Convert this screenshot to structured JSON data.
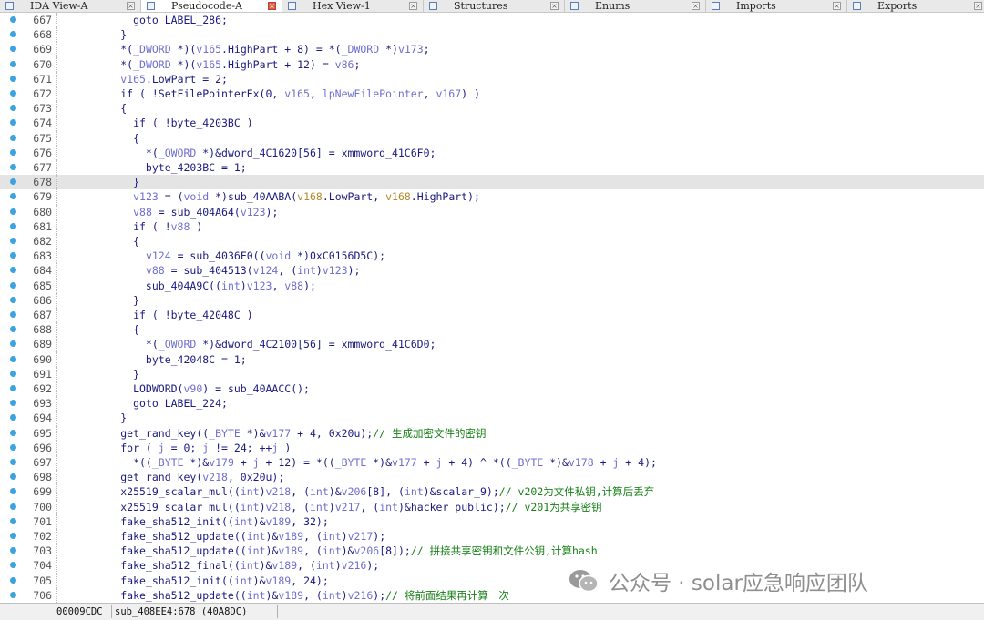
{
  "tabs": [
    {
      "label": "IDA View-A",
      "active": false
    },
    {
      "label": "Pseudocode-A",
      "active": true
    },
    {
      "label": "Hex View-1",
      "active": false
    },
    {
      "label": "Structures",
      "active": false
    },
    {
      "label": "Enums",
      "active": false
    },
    {
      "label": "Imports",
      "active": false
    },
    {
      "label": "Exports",
      "active": false
    }
  ],
  "highlighted_line": "678",
  "lines": [
    {
      "n": "667",
      "t": "            goto LABEL_286;"
    },
    {
      "n": "668",
      "t": "          }"
    },
    {
      "n": "669",
      "t": "          *(_DWORD *)(v165.HighPart + 8) = *(_DWORD *)v173;"
    },
    {
      "n": "670",
      "t": "          *(_DWORD *)(v165.HighPart + 12) = v86;"
    },
    {
      "n": "671",
      "t": "          v165.LowPart = 2;"
    },
    {
      "n": "672",
      "t": "          if ( !SetFilePointerEx(0, v165, lpNewFilePointer, v167) )"
    },
    {
      "n": "673",
      "t": "          {"
    },
    {
      "n": "674",
      "t": "            if ( !byte_4203BC )"
    },
    {
      "n": "675",
      "t": "            {"
    },
    {
      "n": "676",
      "t": "              *(_OWORD *)&dword_4C1620[56] = xmmword_41C6F0;"
    },
    {
      "n": "677",
      "t": "              byte_4203BC = 1;"
    },
    {
      "n": "678",
      "t": "            }"
    },
    {
      "n": "679",
      "t": "            v123 = (void *)sub_40AABA(v168.LowPart, v168.HighPart);"
    },
    {
      "n": "680",
      "t": "            v88 = sub_404A64(v123);"
    },
    {
      "n": "681",
      "t": "            if ( !v88 )"
    },
    {
      "n": "682",
      "t": "            {"
    },
    {
      "n": "683",
      "t": "              v124 = sub_4036F0((void *)0xC0156D5C);"
    },
    {
      "n": "684",
      "t": "              v88 = sub_404513(v124, (int)v123);"
    },
    {
      "n": "685",
      "t": "              sub_404A9C((int)v123, v88);"
    },
    {
      "n": "686",
      "t": "            }"
    },
    {
      "n": "687",
      "t": "            if ( !byte_42048C )"
    },
    {
      "n": "688",
      "t": "            {"
    },
    {
      "n": "689",
      "t": "              *(_OWORD *)&dword_4C2100[56] = xmmword_41C6D0;"
    },
    {
      "n": "690",
      "t": "              byte_42048C = 1;"
    },
    {
      "n": "691",
      "t": "            }"
    },
    {
      "n": "692",
      "t": "            LODWORD(v90) = sub_40AACC();"
    },
    {
      "n": "693",
      "t": "            goto LABEL_224;"
    },
    {
      "n": "694",
      "t": "          }"
    },
    {
      "n": "695",
      "t": "          get_rand_key((_BYTE *)&v177 + 4, 0x20u);// 生成加密文件的密钥"
    },
    {
      "n": "696",
      "t": "          for ( j = 0; j != 24; ++j )"
    },
    {
      "n": "697",
      "t": "            *((_BYTE *)&v179 + j + 12) = *((_BYTE *)&v177 + j + 4) ^ *((_BYTE *)&v178 + j + 4);"
    },
    {
      "n": "698",
      "t": "          get_rand_key(v218, 0x20u);"
    },
    {
      "n": "699",
      "t": "          x25519_scalar_mul((int)v218, (int)&v206[8], (int)&scalar_9);// v202为文件私钥,计算后丢弃"
    },
    {
      "n": "700",
      "t": "          x25519_scalar_mul((int)v218, (int)v217, (int)&hacker_public);// v201为共享密钥"
    },
    {
      "n": "701",
      "t": "          fake_sha512_init((int)&v189, 32);"
    },
    {
      "n": "702",
      "t": "          fake_sha512_update((int)&v189, (int)v217);"
    },
    {
      "n": "703",
      "t": "          fake_sha512_update((int)&v189, (int)&v206[8]);// 拼接共享密钥和文件公钥,计算hash"
    },
    {
      "n": "704",
      "t": "          fake_sha512_final((int)&v189, (int)v216);"
    },
    {
      "n": "705",
      "t": "          fake_sha512_init((int)&v189, 24);"
    },
    {
      "n": "706",
      "t": "          fake_sha512_update((int)&v189, (int)v216);// 将前面结果再计算一次"
    }
  ],
  "statusbar": {
    "offset": "00009CDC",
    "location": "sub_408EE4:678 (40A8DC)"
  },
  "watermark": "公众号 · solar应急响应团队",
  "colors": {
    "dot": "#3da3e0",
    "code_text": "#1a1a80",
    "variable": "#6f6fd0",
    "global": "#b08a2a",
    "comment": "#178017"
  }
}
